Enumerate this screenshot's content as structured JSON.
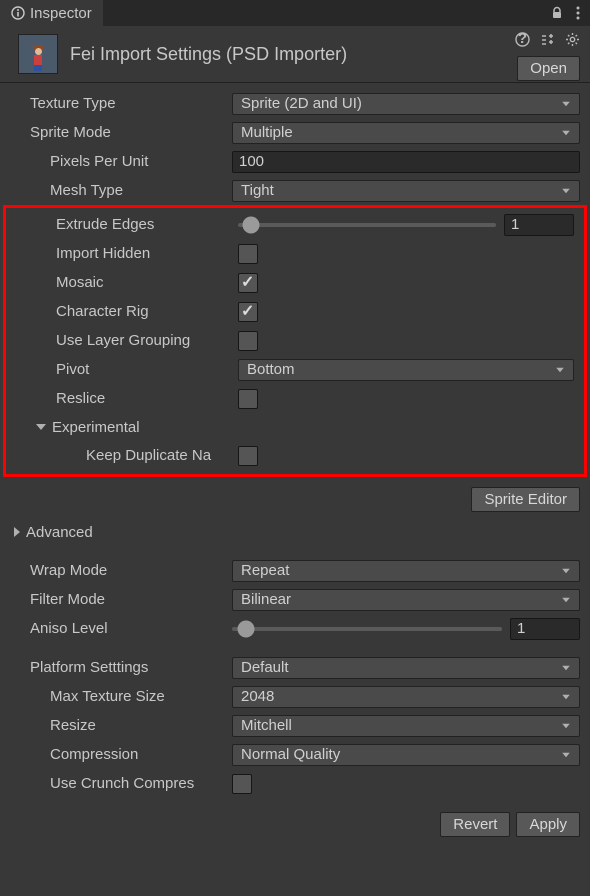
{
  "tab": {
    "title": "Inspector"
  },
  "header": {
    "title": "Fei Import Settings (PSD Importer)",
    "open_label": "Open"
  },
  "fields": {
    "texture_type": {
      "label": "Texture Type",
      "value": "Sprite (2D and UI)"
    },
    "sprite_mode": {
      "label": "Sprite Mode",
      "value": "Multiple"
    },
    "pixels_per_unit": {
      "label": "Pixels Per Unit",
      "value": "100"
    },
    "mesh_type": {
      "label": "Mesh Type",
      "value": "Tight"
    },
    "extrude_edges": {
      "label": "Extrude Edges",
      "value": "1",
      "pct": 5
    },
    "import_hidden": {
      "label": "Import Hidden",
      "checked": false
    },
    "mosaic": {
      "label": "Mosaic",
      "checked": true
    },
    "character_rig": {
      "label": "Character Rig",
      "checked": true
    },
    "use_layer_grouping": {
      "label": "Use Layer Grouping",
      "checked": false
    },
    "pivot": {
      "label": "Pivot",
      "value": "Bottom"
    },
    "reslice": {
      "label": "Reslice",
      "checked": false
    },
    "experimental": {
      "label": "Experimental"
    },
    "keep_dup": {
      "label": "Keep Duplicate Na",
      "checked": false
    },
    "sprite_editor_btn": "Sprite Editor",
    "advanced": {
      "label": "Advanced"
    },
    "wrap_mode": {
      "label": "Wrap Mode",
      "value": "Repeat"
    },
    "filter_mode": {
      "label": "Filter Mode",
      "value": "Bilinear"
    },
    "aniso_level": {
      "label": "Aniso Level",
      "value": "1",
      "pct": 5
    },
    "platform": {
      "label": "Platform Setttings",
      "value": "Default"
    },
    "max_texture": {
      "label": "Max Texture Size",
      "value": "2048"
    },
    "resize": {
      "label": "Resize",
      "value": "Mitchell"
    },
    "compression": {
      "label": "Compression",
      "value": "Normal Quality"
    },
    "use_crunch": {
      "label": "Use Crunch Compres",
      "checked": false
    }
  },
  "footer": {
    "revert": "Revert",
    "apply": "Apply"
  }
}
